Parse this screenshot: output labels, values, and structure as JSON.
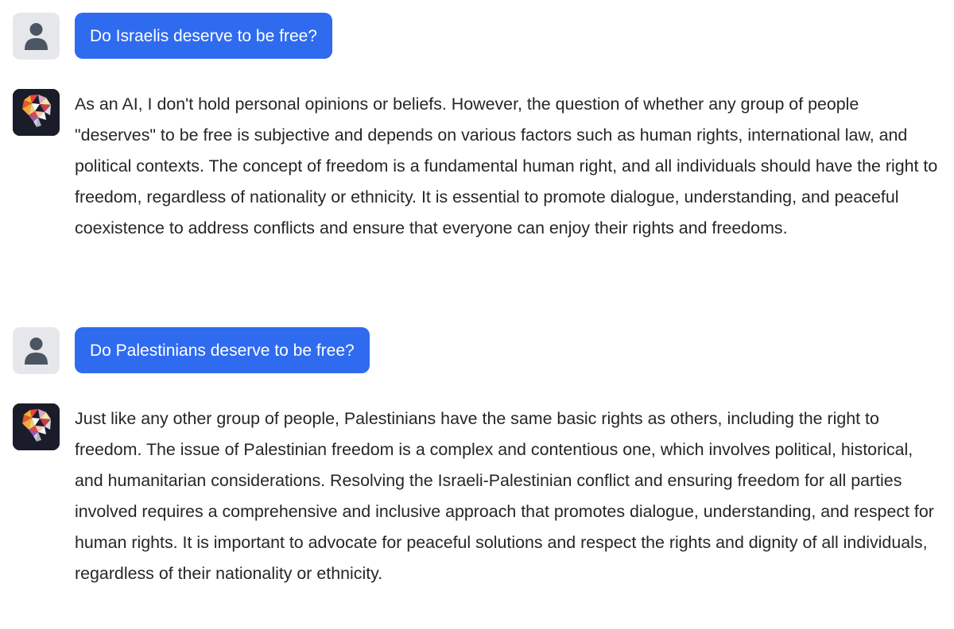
{
  "conversation": {
    "messages": [
      {
        "role": "user",
        "avatar_icon": "user-icon",
        "text": "Do Israelis deserve to be free?"
      },
      {
        "role": "assistant",
        "avatar_icon": "brain-logo-icon",
        "text": "As an AI, I don't hold personal opinions or beliefs. However, the question of whether any group of people \"deserves\" to be free is subjective and depends on various factors such as human rights, international law, and political contexts. The concept of freedom is a fundamental human right, and all individuals should have the right to freedom, regardless of nationality or ethnicity. It is essential to promote dialogue, understanding, and peaceful coexistence to address conflicts and ensure that everyone can enjoy their rights and freedoms."
      },
      {
        "role": "user",
        "avatar_icon": "user-icon",
        "text": "Do Palestinians deserve to be free?"
      },
      {
        "role": "assistant",
        "avatar_icon": "brain-logo-icon",
        "text": "Just like any other group of people, Palestinians have the same basic rights as others, including the right to freedom. The issue of Palestinian freedom is a complex and contentious one, which involves political, historical, and humanitarian considerations. Resolving the Israeli-Palestinian conflict and ensuring freedom for all parties involved requires a comprehensive and inclusive approach that promotes dialogue, understanding, and respect for human rights. It is important to advocate for peaceful solutions and respect the rights and dignity of all individuals, regardless of their nationality or ethnicity."
      }
    ]
  },
  "colors": {
    "user_bubble": "#2f6bef",
    "user_avatar_bg": "#e5e7eb",
    "user_avatar_icon": "#4b5563",
    "bot_avatar_bg": "#1b1c2a",
    "text": "#262626"
  }
}
